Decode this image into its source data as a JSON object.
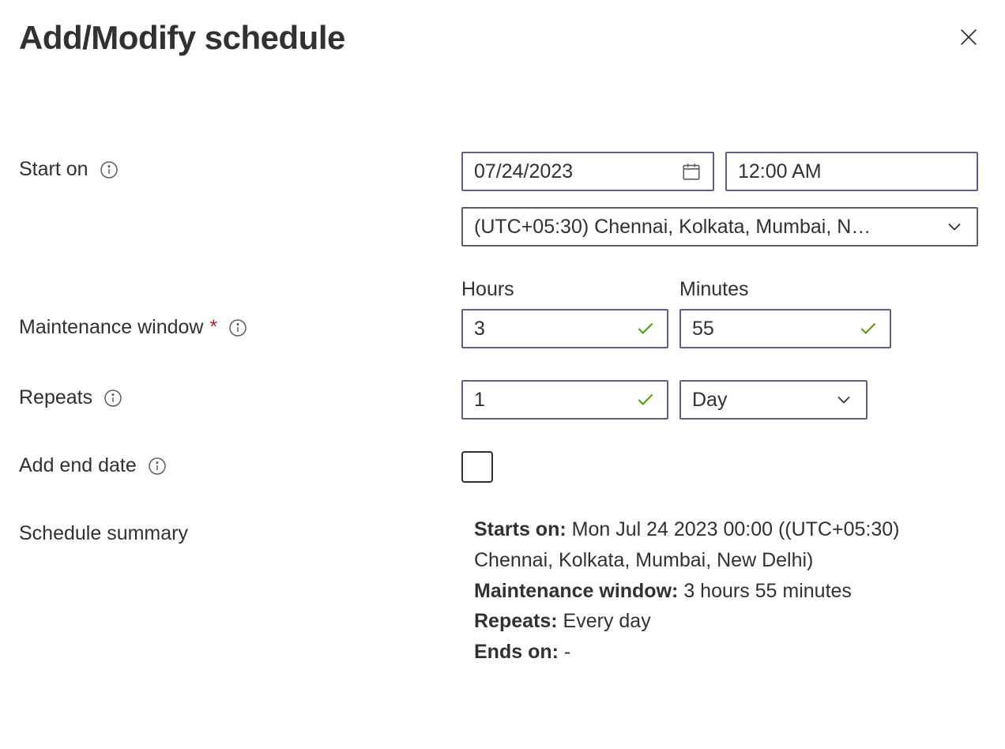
{
  "header": {
    "title": "Add/Modify schedule"
  },
  "fields": {
    "startOn": {
      "label": "Start on",
      "date": "07/24/2023",
      "time": "12:00 AM",
      "timezone": "(UTC+05:30) Chennai, Kolkata, Mumbai, N…"
    },
    "maintenanceWindow": {
      "label": "Maintenance window",
      "hoursLabel": "Hours",
      "minutesLabel": "Minutes",
      "hours": "3",
      "minutes": "55"
    },
    "repeats": {
      "label": "Repeats",
      "count": "1",
      "unit": "Day"
    },
    "addEndDate": {
      "label": "Add end date"
    },
    "summary": {
      "label": "Schedule summary",
      "startsOnLabel": "Starts on:",
      "startsOnValue": "Mon Jul 24 2023 00:00 ((UTC+05:30) Chennai, Kolkata, Mumbai, New Delhi)",
      "mwLabel": "Maintenance window:",
      "mwValue": "3 hours 55 minutes",
      "repeatsLabel": "Repeats:",
      "repeatsValue": "Every day",
      "endsOnLabel": "Ends on:",
      "endsOnValue": "-"
    }
  }
}
